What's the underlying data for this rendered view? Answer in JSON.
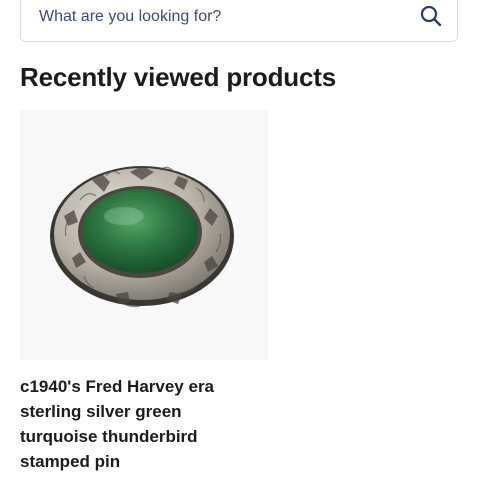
{
  "search": {
    "placeholder": "What are you looking for?"
  },
  "recently_viewed": {
    "title": "Recently viewed products",
    "products": [
      {
        "title": "c1940's Fred Harvey era sterling silver green turquoise thunderbird stamped pin",
        "image_icon": "oval-green-stone-silver-pin"
      }
    ]
  }
}
